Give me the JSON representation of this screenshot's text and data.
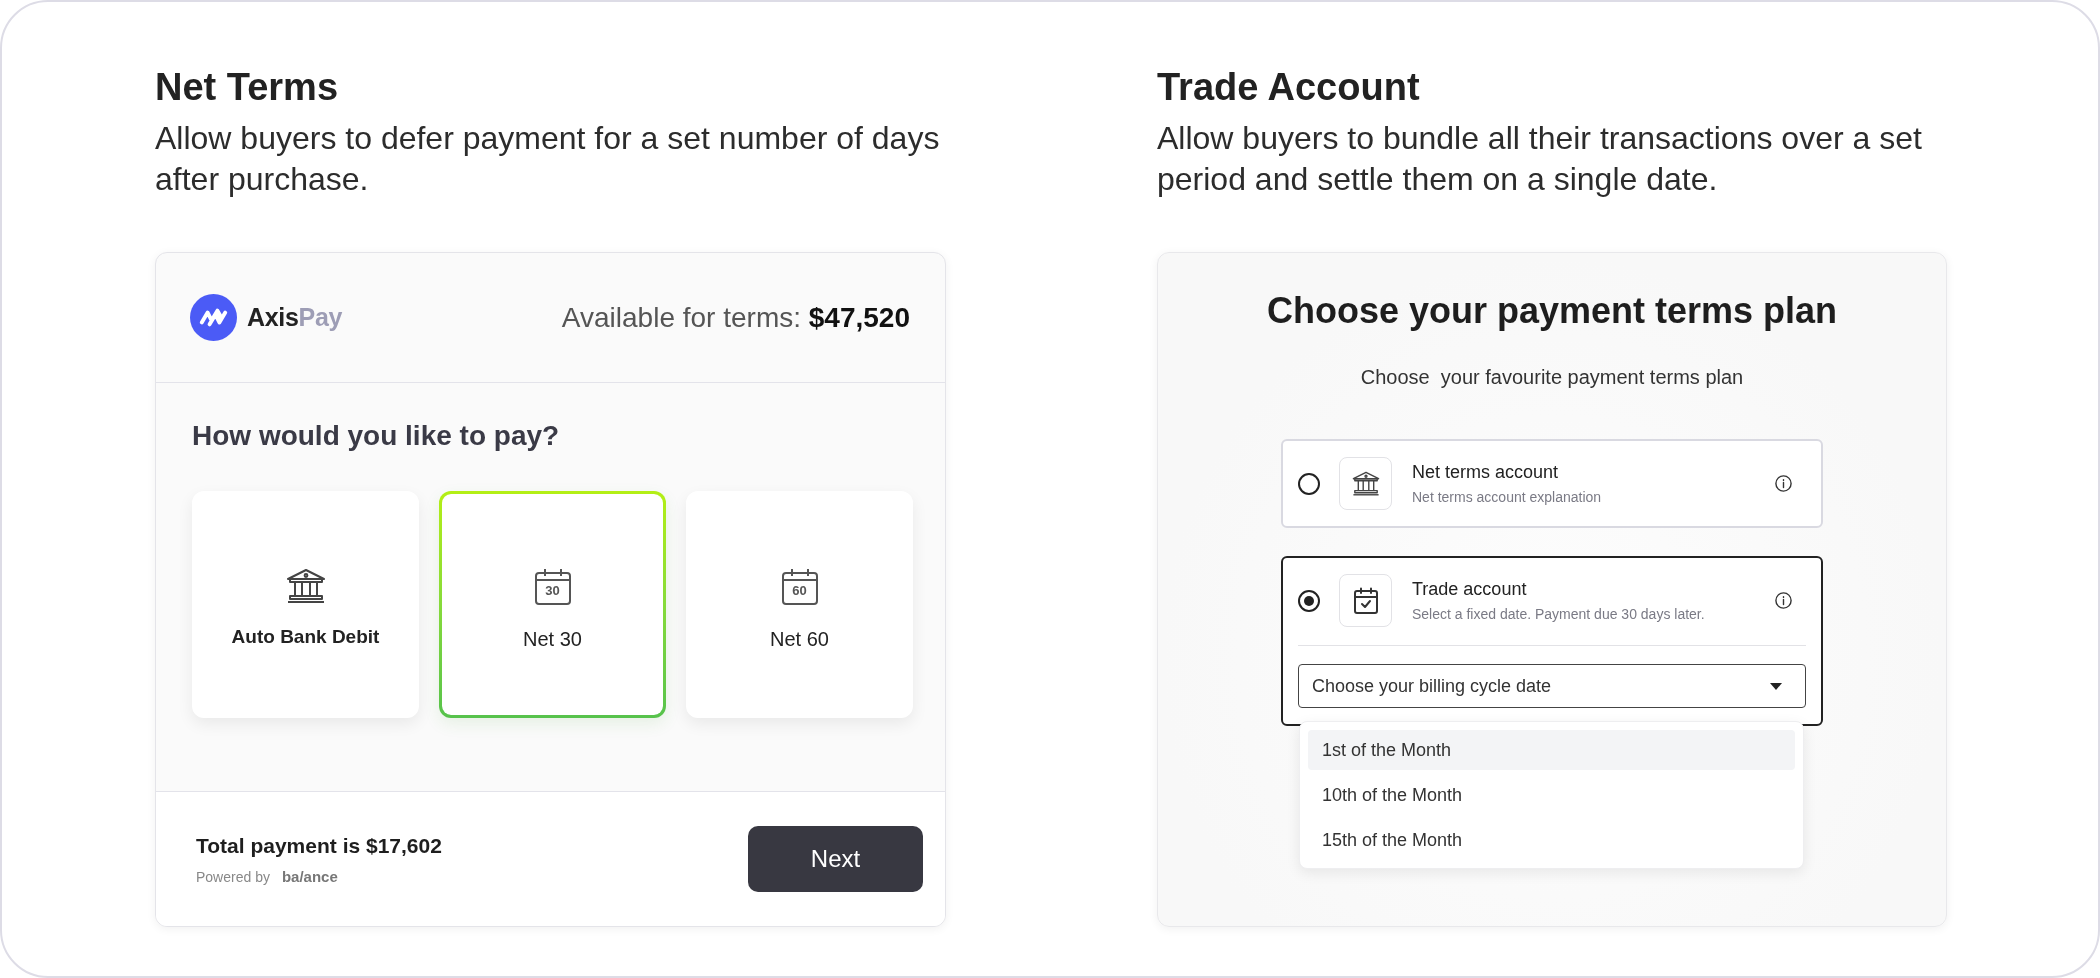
{
  "net_terms": {
    "title": "Net Terms",
    "description": "Allow buyers to defer payment for a set number of days after purchase.",
    "checkout": {
      "brand": {
        "name": "Axis",
        "suffix": "Pay"
      },
      "available": "Available for terms: **$47,520**",
      "question": "How would you like to pay?",
      "options": [
        {
          "kind": "bank",
          "label": "Auto Bank Debit",
          "selected": false
        },
        {
          "kind": "calendar",
          "day": "30",
          "label": "Net 30",
          "selected": true
        },
        {
          "kind": "calendar",
          "day": "60",
          "label": "Net 60",
          "selected": false
        }
      ],
      "total": "Total payment is $17,602",
      "powered_by": "Powered by",
      "provider": "ba/ance",
      "next_button": "Next"
    }
  },
  "trade_account": {
    "title": "Trade Account",
    "description": "Allow buyers to bundle all their transactions over a set period and settle them on a single date.",
    "plan_picker": {
      "title": "Choose your payment terms plan",
      "subtitle": "Choose  your favourite payment terms plan",
      "plans": [
        {
          "kind": "bank",
          "title": "Net terms account",
          "description": "Net terms account explanation",
          "selected": false
        },
        {
          "kind": "calendar",
          "title": "Trade account",
          "description": "Select a fixed date. Payment due 30 days later.",
          "selected": true,
          "select": {
            "placeholder": "Choose your billing cycle date",
            "expanded": true,
            "options": [
              {
                "label": "1st of the Month",
                "highlighted": true
              },
              {
                "label": "10th of the Month",
                "highlighted": false
              },
              {
                "label": "15th of the Month",
                "highlighted": false
              }
            ]
          }
        }
      ]
    }
  }
}
